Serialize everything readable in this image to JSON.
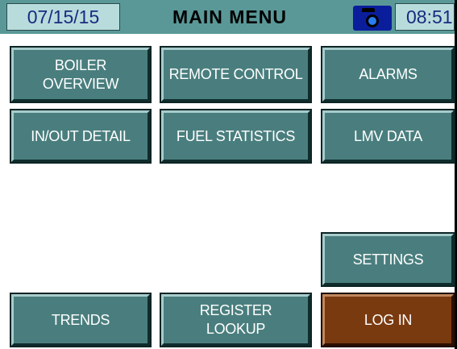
{
  "header": {
    "date": "07/15/15",
    "title": "MAIN MENU",
    "time": "08:51",
    "camera_icon": "camera-icon"
  },
  "buttons": {
    "boiler_overview": "BOILER\nOVERVIEW",
    "remote_control": "REMOTE CONTROL",
    "alarms": "ALARMS",
    "in_out_detail": "IN/OUT DETAIL",
    "fuel_statistics": "FUEL STATISTICS",
    "lmv_data": "LMV DATA",
    "settings": "SETTINGS",
    "trends": "TRENDS",
    "register_lookup": "REGISTER\nLOOKUP",
    "log_in": "LOG IN"
  },
  "colors": {
    "header_bg": "#5a9898",
    "button_bg": "#4a7e7e",
    "login_bg": "#7a3a10",
    "header_text": "#1a2a80"
  }
}
